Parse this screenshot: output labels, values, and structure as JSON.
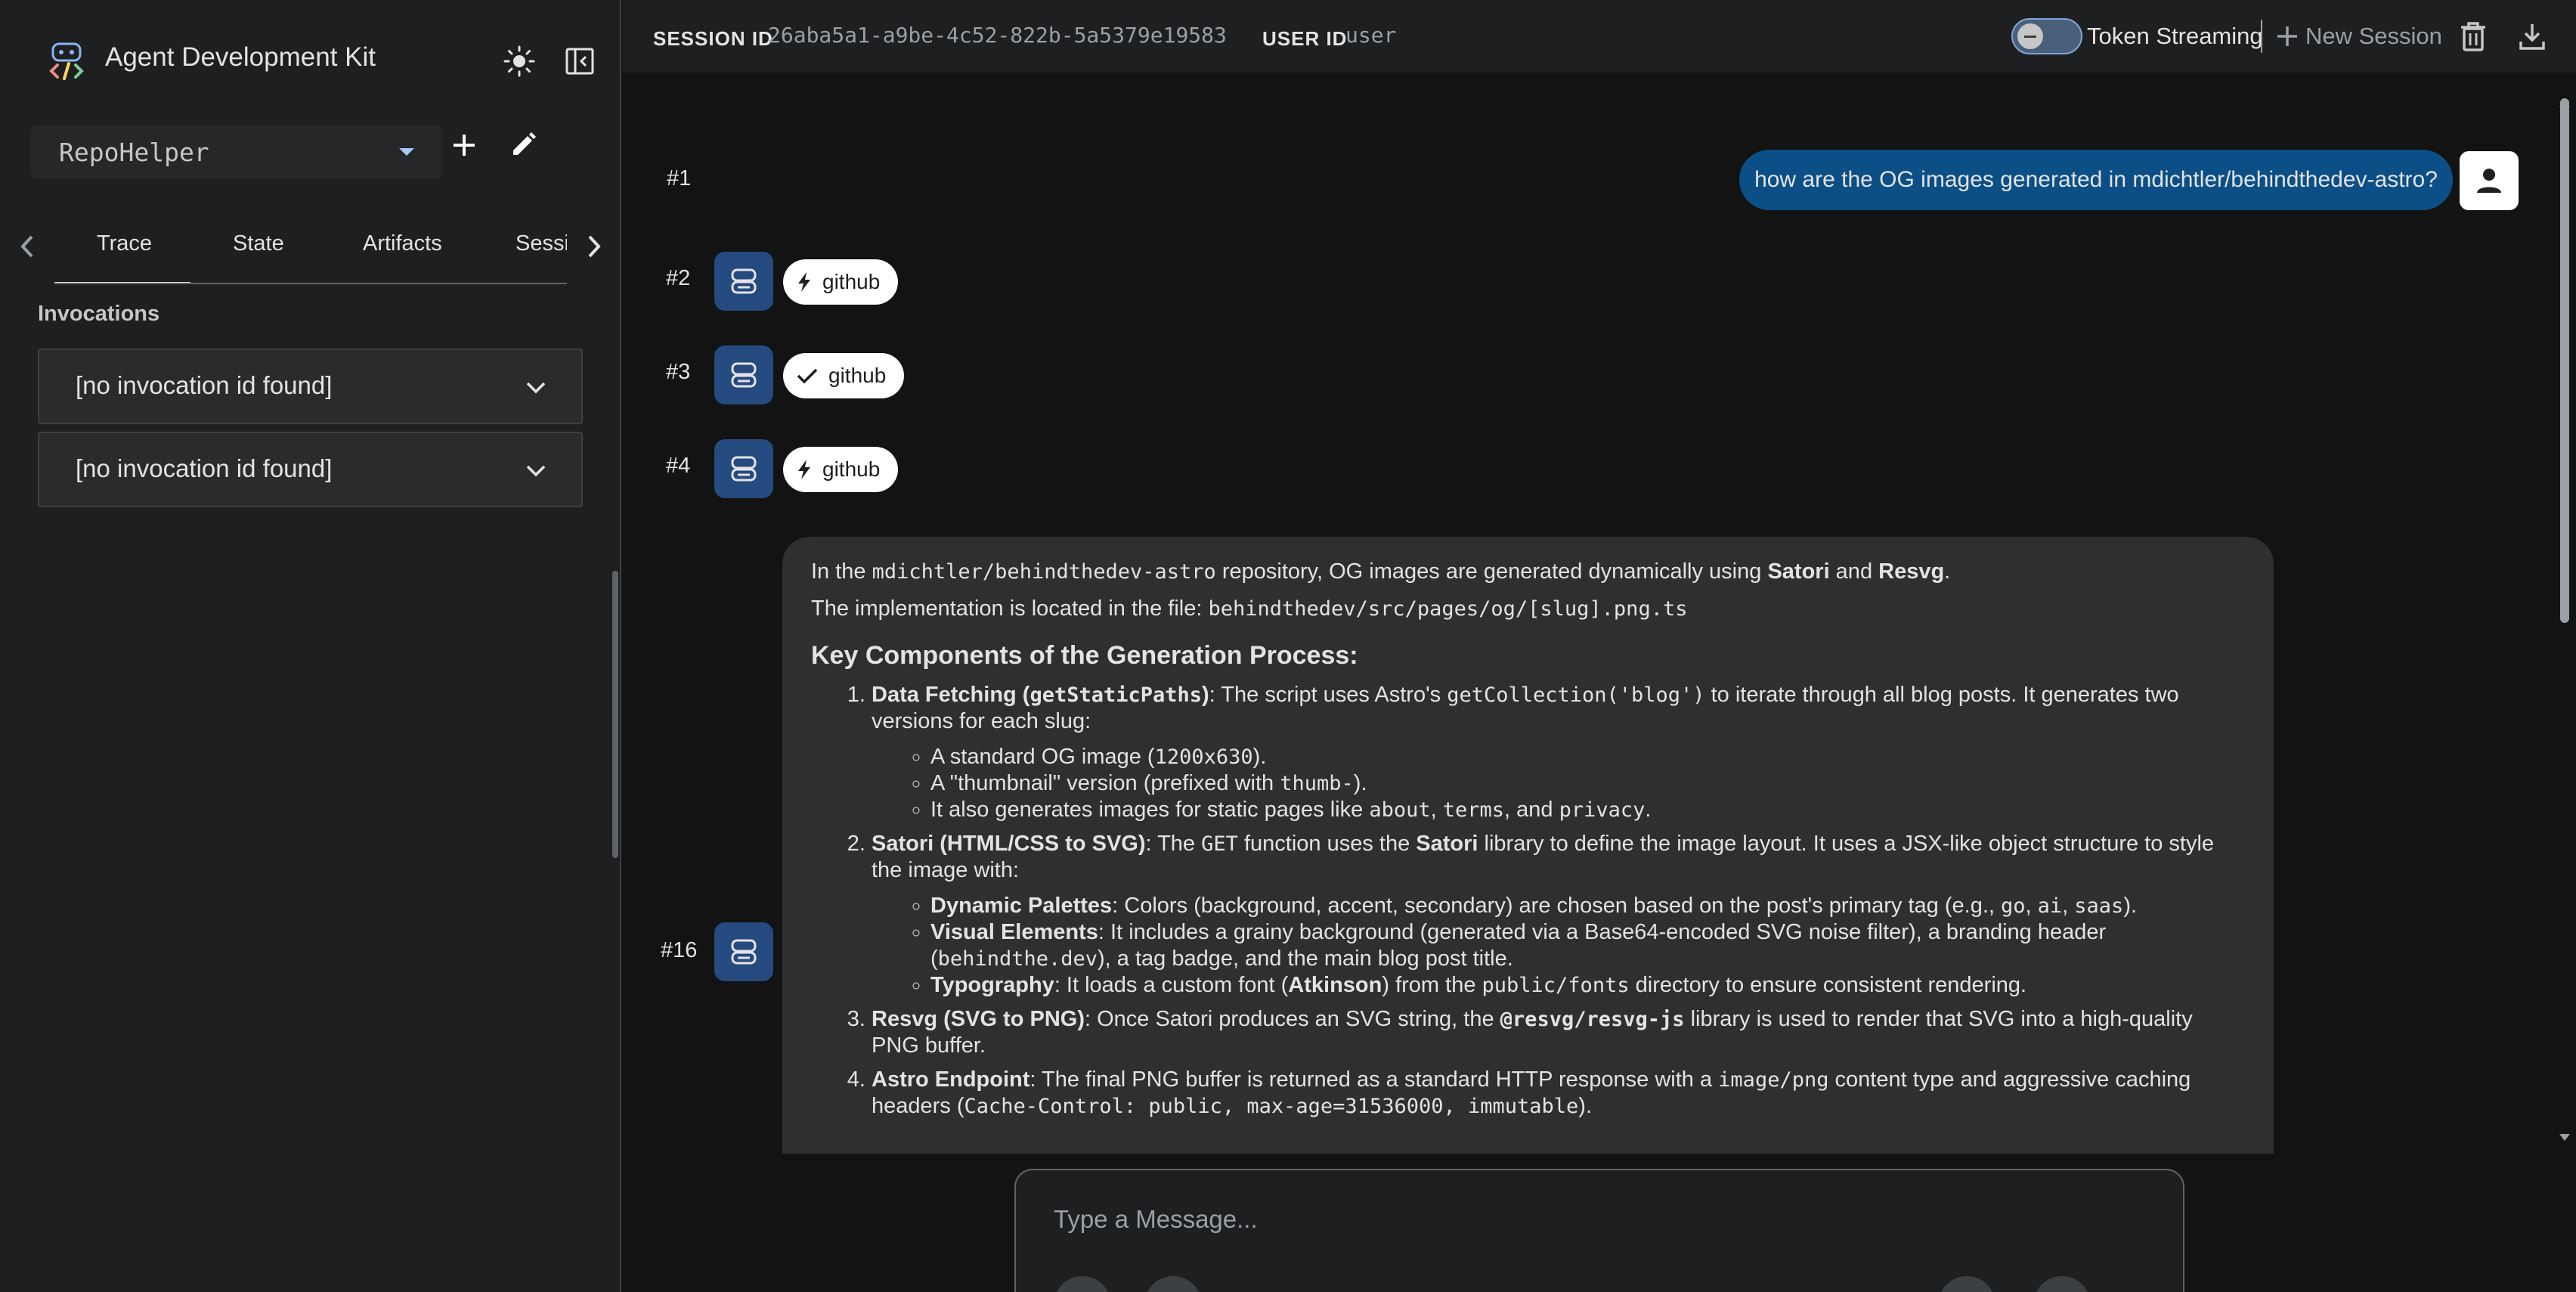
{
  "app": {
    "title": "Agent Development Kit",
    "theme_icon": "sun-icon",
    "collapse_icon": "sidebar-collapse-icon"
  },
  "sidebar": {
    "agent_select": {
      "value": "RepoHelper"
    },
    "tabs": [
      {
        "label": "Trace",
        "active": true
      },
      {
        "label": "State",
        "active": false
      },
      {
        "label": "Artifacts",
        "active": false
      },
      {
        "label": "Sessi",
        "active": false
      }
    ],
    "invocations_heading": "Invocations",
    "invocations": [
      {
        "label": "[no invocation id found]"
      },
      {
        "label": "[no invocation id found]"
      }
    ]
  },
  "topbar": {
    "session_label": "SESSION ID",
    "session_id": "26aba5a1-a9be-4c52-822b-5a5379e19583",
    "user_label": "USER ID",
    "user_id": "user",
    "token_streaming_label": "Token Streaming",
    "token_streaming_on": false,
    "new_session_label": "New Session"
  },
  "chat": {
    "user_message": {
      "turn": "#1",
      "text": "how are the OG images generated in mdichtler/behindthedev-astro?"
    },
    "tool_events": [
      {
        "turn": "#2",
        "label": "github",
        "icon": "bolt-icon"
      },
      {
        "turn": "#3",
        "label": "github",
        "icon": "check-icon"
      },
      {
        "turn": "#4",
        "label": "github",
        "icon": "bolt-icon"
      }
    ],
    "response": {
      "turn": "#16",
      "p1_a": "In the ",
      "p1_code": "mdichtler/behindthedev-astro",
      "p1_b": " repository, OG images are generated dynamically using ",
      "p1_bold1": "Satori",
      "p1_c": " and ",
      "p1_bold2": "Resvg",
      "p1_d": ".",
      "p2_a": "The implementation is located in the file: ",
      "p2_code": "behindthedev/src/pages/og/[slug].png.ts",
      "heading": "Key Components of the Generation Process:",
      "item1_title": "Data Fetching (",
      "item1_title_code": "getStaticPaths",
      "item1_title_end": ")",
      "item1_a": ": The script uses Astro's ",
      "item1_code": "getCollection('blog')",
      "item1_b": " to iterate through all blog posts. It generates two versions for each slug:",
      "item1_sub1_a": "A standard OG image (",
      "item1_sub1_code": "1200x630",
      "item1_sub1_b": ").",
      "item1_sub2_a": "A \"thumbnail\" version (prefixed with ",
      "item1_sub2_code": "thumb-",
      "item1_sub2_b": ").",
      "item1_sub3_a": "It also generates images for static pages like ",
      "item1_sub3_code1": "about",
      "item1_sub3_sep1": ", ",
      "item1_sub3_code2": "terms",
      "item1_sub3_sep2": ", and ",
      "item1_sub3_code3": "privacy",
      "item1_sub3_end": ".",
      "item2_title": "Satori (HTML/CSS to SVG)",
      "item2_a": ": The ",
      "item2_code": "GET",
      "item2_b": " function uses the ",
      "item2_bold": "Satori",
      "item2_c": " library to define the image layout. It uses a JSX-like object structure to style the image with:",
      "item2_sub1_title": "Dynamic Palettes",
      "item2_sub1_a": ": Colors (background, accent, secondary) are chosen based on the post's primary tag (e.g., ",
      "item2_sub1_code1": "go",
      "item2_sub1_sep1": ", ",
      "item2_sub1_code2": "ai",
      "item2_sub1_sep2": ", ",
      "item2_sub1_code3": "saas",
      "item2_sub1_end": ").",
      "item2_sub2_title": "Visual Elements",
      "item2_sub2_a": ": It includes a grainy background (generated via a Base64-encoded SVG noise filter), a branding header (",
      "item2_sub2_code": "behindthe.dev",
      "item2_sub2_b": "), a tag badge, and the main blog post title.",
      "item2_sub3_title": "Typography",
      "item2_sub3_a": ": It loads a custom font (",
      "item2_sub3_bold": "Atkinson",
      "item2_sub3_b": ") from the ",
      "item2_sub3_code": "public/fonts",
      "item2_sub3_c": " directory to ensure consistent rendering.",
      "item3_title": "Resvg (SVG to PNG)",
      "item3_a": ": Once Satori produces an SVG string, the ",
      "item3_code": "@resvg/resvg-js",
      "item3_b": " library is used to render that SVG into a high-quality PNG buffer.",
      "item4_title": "Astro Endpoint",
      "item4_a": ": The final PNG buffer is returned as a standard HTTP response with a ",
      "item4_code1": "image/png",
      "item4_b": " content type and aggressive caching headers (",
      "item4_code2": "Cache-Control: public, max-age=31536000, immutable",
      "item4_c": ")."
    }
  },
  "input": {
    "placeholder": "Type a Message..."
  }
}
